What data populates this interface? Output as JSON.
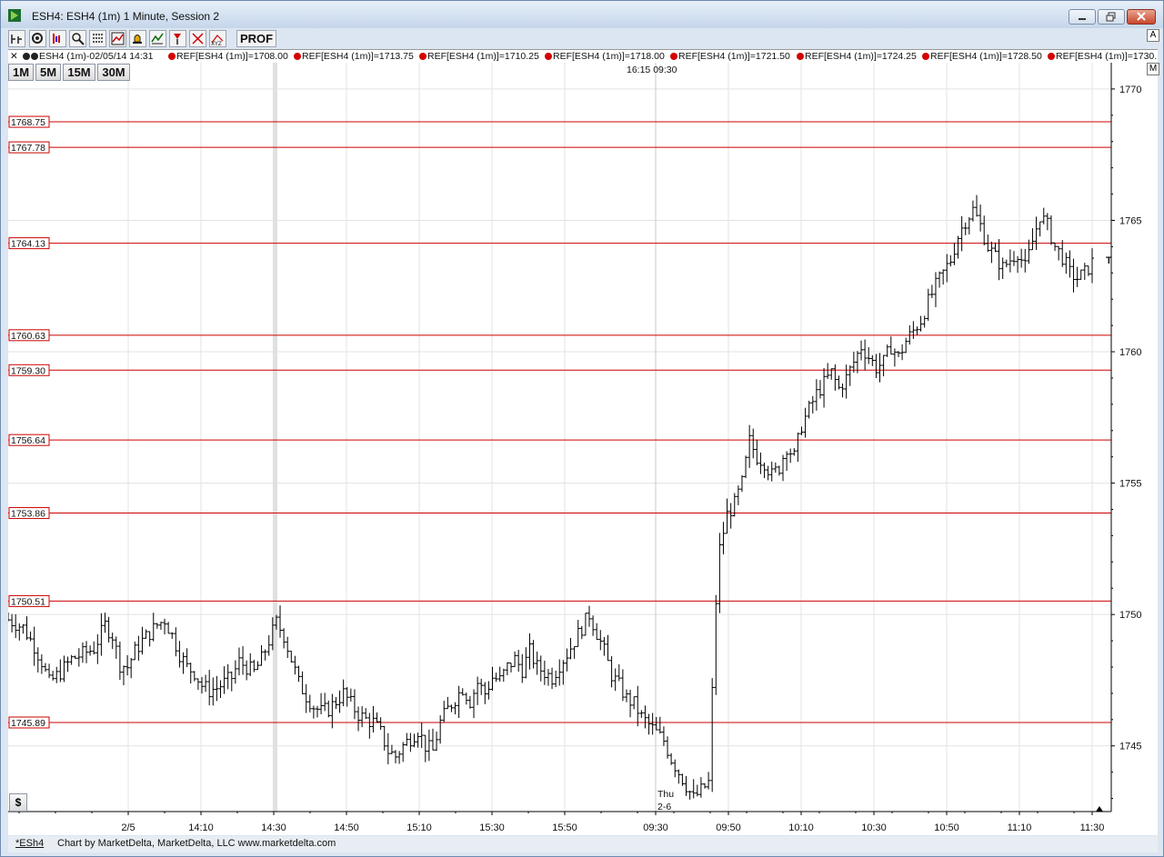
{
  "window": {
    "title": "ESH4: ESH4 (1m) 1 Minute, Session 2"
  },
  "toolbar": {
    "icons": [
      "chart-type-icon",
      "settings-icon",
      "bar-style-icon",
      "zoom-icon",
      "grid-icon",
      "line-chart-icon",
      "alert-bell-icon",
      "study-icon",
      "marker-icon",
      "draw-tool-icon",
      "xyz-icon"
    ],
    "prof_label": "PROF"
  },
  "legend": {
    "symbol": "ESH4 (1m)-02/05/14 14:31",
    "refs": [
      "REF[ESH4 (1m)]=1708.00",
      "REF[ESH4 (1m)]=1713.75",
      "REF[ESH4 (1m)]=1710.25",
      "REF[ESH4 (1m)]=1718.00",
      "REF[ESH4 (1m)]=1721.50",
      "REF[ESH4 (1m)]=1724.25",
      "REF[ESH4 (1m)]=1728.50",
      "REF[ESH4 (1m)]=1730."
    ],
    "corner_label": "A",
    "scale_label": "M"
  },
  "timeframes": [
    "1M",
    "5M",
    "15M",
    "30M"
  ],
  "session_marker": "16:15  09:30",
  "date_marker": {
    "day": "Thu",
    "date": "2-6"
  },
  "statusbar": {
    "tab": "*ESh4",
    "credit": "Chart by MarketDelta, MarketDelta, LLC www.marketdelta.com"
  },
  "colors": {
    "ref_line": "#cc0000",
    "bar": "#000000",
    "grid": "#e3e3e3",
    "session_band": "#e0e0e0"
  },
  "chart_data": {
    "type": "ohlc",
    "title": "ESH4 (1m) 1 Minute",
    "ylim": [
      1742.5,
      1771
    ],
    "y_ticks": [
      1745,
      1750,
      1755,
      1760,
      1765,
      1770
    ],
    "x_tick_labels": [
      "2/5",
      "14:10",
      "14:30",
      "14:50",
      "15:10",
      "15:30",
      "15:50",
      "09:30",
      "09:50",
      "10:10",
      "10:30",
      "10:50",
      "11:10",
      "11:30"
    ],
    "ref_levels": [
      1768.75,
      1767.78,
      1764.13,
      1760.63,
      1759.3,
      1756.64,
      1753.86,
      1750.51,
      1745.89
    ],
    "ref_labels": [
      "1768.75",
      "1767.78",
      "1764.13",
      "1760.63",
      "1759.30",
      "1756.64",
      "1753.86",
      "1750.51",
      "1745.89"
    ],
    "close_path": [
      [
        0,
        1749.8
      ],
      [
        4,
        1749.5
      ],
      [
        7,
        1748.8
      ],
      [
        9,
        1748.2
      ],
      [
        11,
        1747.4
      ],
      [
        14,
        1747.8
      ],
      [
        17,
        1748.3
      ],
      [
        20,
        1748.5
      ],
      [
        23,
        1748.7
      ],
      [
        26,
        1749.6
      ],
      [
        28,
        1749.2
      ],
      [
        30,
        1748.1
      ],
      [
        32,
        1748.0
      ],
      [
        34,
        1748.6
      ],
      [
        36,
        1749.0
      ],
      [
        38,
        1749.3
      ],
      [
        40,
        1749.6
      ],
      [
        42,
        1749.8
      ],
      [
        44,
        1749.2
      ],
      [
        46,
        1748.5
      ],
      [
        48,
        1748.0
      ],
      [
        50,
        1747.8
      ],
      [
        52,
        1747.3
      ],
      [
        54,
        1747.1
      ],
      [
        56,
        1747.2
      ],
      [
        58,
        1747.4
      ],
      [
        60,
        1747.6
      ],
      [
        62,
        1748.2
      ],
      [
        64,
        1748.0
      ],
      [
        66,
        1747.8
      ],
      [
        68,
        1748.3
      ],
      [
        70,
        1749.0
      ],
      [
        72,
        1749.7
      ],
      [
        74,
        1749.2
      ],
      [
        76,
        1748.3
      ],
      [
        78,
        1747.4
      ],
      [
        80,
        1746.9
      ],
      [
        82,
        1746.5
      ],
      [
        84,
        1746.3
      ],
      [
        86,
        1746.4
      ],
      [
        88,
        1746.7
      ],
      [
        90,
        1747.0
      ],
      [
        92,
        1746.6
      ],
      [
        94,
        1746.2
      ],
      [
        96,
        1746.0
      ],
      [
        98,
        1745.9
      ],
      [
        100,
        1745.5
      ],
      [
        102,
        1744.8
      ],
      [
        104,
        1744.6
      ],
      [
        106,
        1745.0
      ],
      [
        108,
        1745.3
      ],
      [
        110,
        1745.6
      ],
      [
        112,
        1745.0
      ],
      [
        114,
        1744.8
      ],
      [
        116,
        1745.9
      ],
      [
        118,
        1746.4
      ],
      [
        120,
        1746.8
      ],
      [
        122,
        1747.2
      ],
      [
        124,
        1746.7
      ],
      [
        126,
        1747.4
      ],
      [
        128,
        1747.0
      ],
      [
        130,
        1747.6
      ],
      [
        132,
        1747.5
      ],
      [
        134,
        1748.0
      ],
      [
        136,
        1748.3
      ],
      [
        138,
        1747.9
      ],
      [
        140,
        1748.6
      ],
      [
        142,
        1748.0
      ],
      [
        144,
        1747.8
      ],
      [
        146,
        1747.6
      ],
      [
        148,
        1748.1
      ],
      [
        150,
        1748.5
      ],
      [
        152,
        1749.0
      ],
      [
        154,
        1749.5
      ],
      [
        156,
        1750.0
      ],
      [
        158,
        1749.3
      ],
      [
        160,
        1748.6
      ],
      [
        162,
        1747.7
      ],
      [
        164,
        1747.3
      ],
      [
        166,
        1746.8
      ],
      [
        168,
        1746.6
      ],
      [
        170,
        1746.1
      ],
      [
        172,
        1745.8
      ],
      [
        174,
        1745.5
      ],
      [
        176,
        1745.2
      ],
      [
        178,
        1744.5
      ],
      [
        180,
        1744.0
      ],
      [
        182,
        1743.5
      ],
      [
        184,
        1743.0
      ],
      [
        186,
        1743.3
      ],
      [
        188,
        1743.6
      ],
      [
        190,
        1750.5
      ],
      [
        191,
        1752.5
      ],
      [
        193,
        1753.8
      ],
      [
        195,
        1754.2
      ],
      [
        197,
        1755.0
      ],
      [
        199,
        1756.6
      ],
      [
        201,
        1756.0
      ],
      [
        203,
        1755.8
      ],
      [
        205,
        1755.3
      ],
      [
        207,
        1755.6
      ],
      [
        209,
        1756.4
      ],
      [
        211,
        1756.0
      ],
      [
        213,
        1757.2
      ],
      [
        215,
        1757.8
      ],
      [
        217,
        1758.4
      ],
      [
        219,
        1758.8
      ],
      [
        221,
        1759.2
      ],
      [
        223,
        1758.6
      ],
      [
        225,
        1759.0
      ],
      [
        227,
        1759.6
      ],
      [
        229,
        1760.2
      ],
      [
        231,
        1759.8
      ],
      [
        233,
        1759.4
      ],
      [
        235,
        1759.6
      ],
      [
        237,
        1760.2
      ],
      [
        239,
        1759.8
      ],
      [
        241,
        1760.4
      ],
      [
        243,
        1760.8
      ],
      [
        245,
        1761.2
      ],
      [
        247,
        1761.9
      ],
      [
        249,
        1762.5
      ],
      [
        251,
        1763.0
      ],
      [
        253,
        1763.5
      ],
      [
        255,
        1764.4
      ],
      [
        257,
        1765.0
      ],
      [
        259,
        1765.4
      ],
      [
        261,
        1764.8
      ],
      [
        263,
        1764.0
      ],
      [
        265,
        1763.6
      ],
      [
        267,
        1763.2
      ],
      [
        269,
        1763.5
      ],
      [
        271,
        1763.8
      ],
      [
        273,
        1763.2
      ],
      [
        275,
        1764.2
      ],
      [
        277,
        1765.2
      ],
      [
        279,
        1764.8
      ],
      [
        281,
        1764.0
      ],
      [
        283,
        1763.6
      ],
      [
        285,
        1763.0
      ],
      [
        287,
        1762.8
      ],
      [
        289,
        1763.0
      ],
      [
        291,
        1763.4
      ]
    ]
  }
}
